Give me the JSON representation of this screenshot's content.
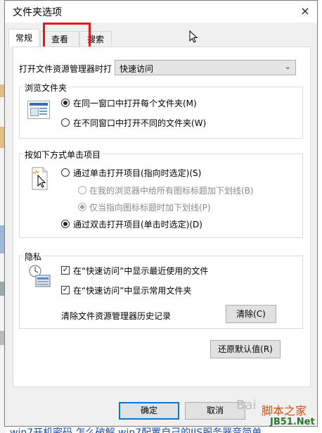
{
  "dialog": {
    "title": "文件夹选项",
    "close_icon": "×",
    "tabs": [
      "常规",
      "查看",
      "搜索"
    ],
    "open_label": "打开文件资源管理器时打",
    "open_value": "快速访问",
    "browse_group": {
      "title": "浏览文件夹",
      "options": [
        "在同一窗口中打开每个文件夹(M)",
        "在不同窗口中打开不同的文件夹(W)"
      ]
    },
    "click_group": {
      "title": "按如下方式单击项目",
      "single": "通过单击打开项目(指向时选定)(S)",
      "underline_browser": "在我的浏览器中给所有图标标题加下划线(B)",
      "underline_hover": "仅当指向图标标题时加下划线(P)",
      "double": "通过双击打开项目(单击时选定)(D)"
    },
    "privacy_group": {
      "title": "隐私",
      "recent_files": "在“快速访问”中显示最近使用的文件",
      "frequent_folders": "在“快速访问”中显示常用文件夹",
      "clear_history_label": "清除文件资源管理器历史记录",
      "clear_button": "清除(C)"
    },
    "restore_defaults": "还原默认值(R)",
    "ok": "确定",
    "cancel": "取消"
  },
  "watermarks": {
    "baidu": "Bai",
    "site_cn": "脚本之家",
    "site_en": "JB51.Net"
  },
  "background_text": "…win7开机密码 怎么破解    win7配置自己的IIS服务器音简单"
}
